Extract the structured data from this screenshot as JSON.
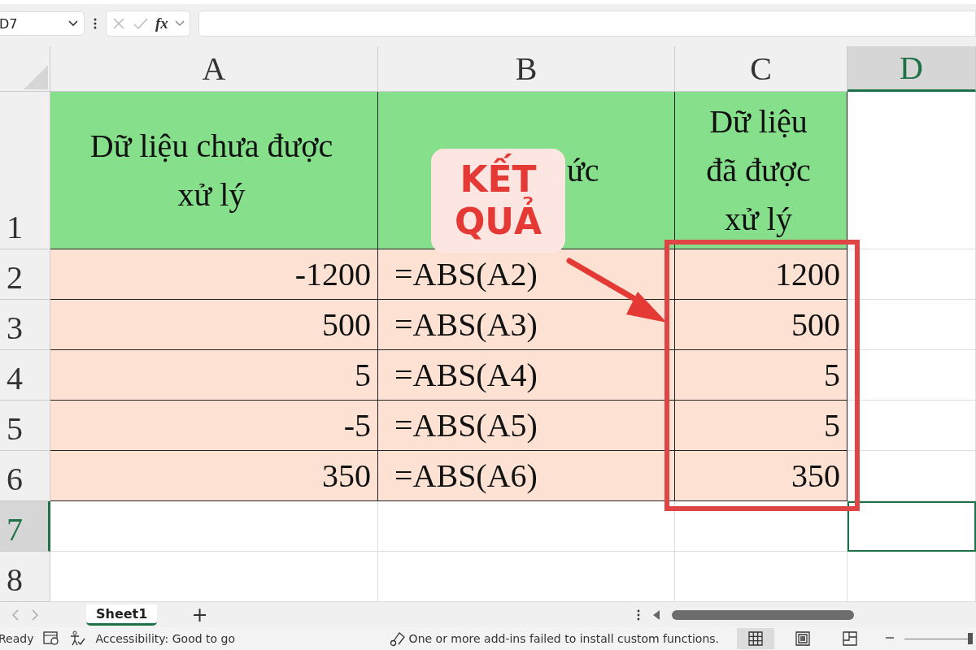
{
  "formula_bar": {
    "name_box": "D7",
    "function_label": "fx"
  },
  "columns": [
    {
      "label": "A",
      "selected": false
    },
    {
      "label": "B",
      "selected": false
    },
    {
      "label": "C",
      "selected": false
    },
    {
      "label": "D",
      "selected": true
    }
  ],
  "rows": [
    {
      "label": "1",
      "selected": false,
      "kind": "header",
      "cells": [
        {
          "text": "Dữ liệu chưa được xử lý",
          "kind": "heading"
        },
        {
          "text": "ức",
          "kind": "partial"
        },
        {
          "text": "Dữ liệu đã được xử lý",
          "kind": "heading"
        }
      ]
    },
    {
      "label": "2",
      "selected": false,
      "kind": "data",
      "cells": [
        {
          "text": "-1200",
          "kind": "number"
        },
        {
          "text": "=ABS(A2)",
          "kind": "formula"
        },
        {
          "text": "1200",
          "kind": "number"
        }
      ]
    },
    {
      "label": "3",
      "selected": false,
      "kind": "data",
      "cells": [
        {
          "text": "500",
          "kind": "number"
        },
        {
          "text": "=ABS(A3)",
          "kind": "formula"
        },
        {
          "text": "500",
          "kind": "number"
        }
      ]
    },
    {
      "label": "4",
      "selected": false,
      "kind": "data",
      "cells": [
        {
          "text": "5",
          "kind": "number"
        },
        {
          "text": "=ABS(A4)",
          "kind": "formula"
        },
        {
          "text": "5",
          "kind": "number"
        }
      ]
    },
    {
      "label": "5",
      "selected": false,
      "kind": "data",
      "cells": [
        {
          "text": "-5",
          "kind": "number"
        },
        {
          "text": "=ABS(A5)",
          "kind": "formula"
        },
        {
          "text": "5",
          "kind": "number"
        }
      ]
    },
    {
      "label": "6",
      "selected": false,
      "kind": "data",
      "cells": [
        {
          "text": "350",
          "kind": "number"
        },
        {
          "text": "=ABS(A6)",
          "kind": "formula"
        },
        {
          "text": "350",
          "kind": "number"
        }
      ]
    },
    {
      "label": "7",
      "selected": true,
      "kind": "empty",
      "cells": []
    },
    {
      "label": "8",
      "selected": false,
      "kind": "empty",
      "cells": []
    }
  ],
  "callout": {
    "text": "KẾT QUẢ"
  },
  "sheet_tabs": [
    {
      "label": "Sheet1",
      "selected": true
    }
  ],
  "add_sheet": "+",
  "status_bar": {
    "mode": "Ready",
    "accessibility": "Accessibility: Good to go",
    "message": "One or more add-ins failed to install custom functions.",
    "zoom_slider": {
      "level": 0.97
    },
    "view_modes": [
      {
        "kind": "normal",
        "selected": true
      },
      {
        "kind": "page_layout",
        "selected": false
      },
      {
        "kind": "page_break",
        "selected": false
      }
    ]
  }
}
